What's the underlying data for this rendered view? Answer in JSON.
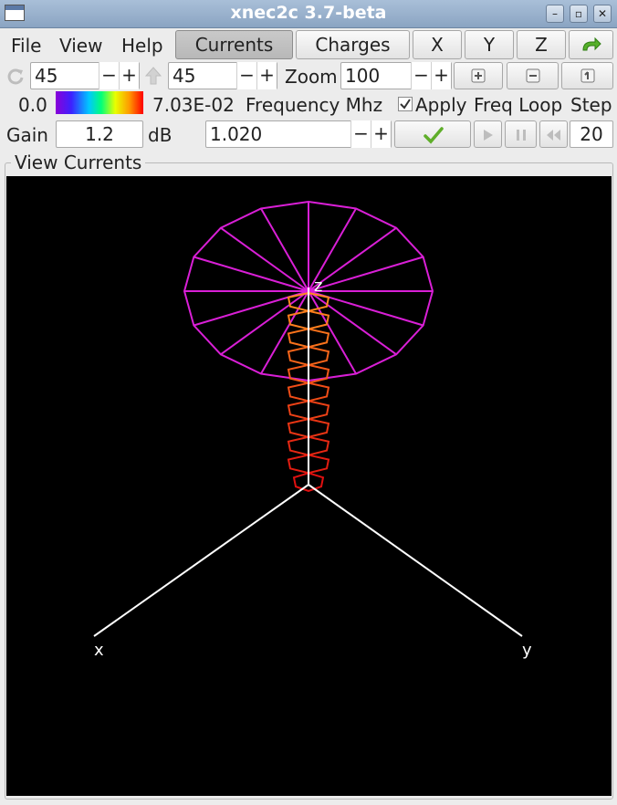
{
  "window": {
    "title": "xnec2c 3.7-beta"
  },
  "menus": [
    "File",
    "View",
    "Help"
  ],
  "toolbar": {
    "currents_label": "Currents",
    "charges_label": "Charges",
    "x_label": "X",
    "y_label": "Y",
    "z_label": "Z"
  },
  "row2": {
    "rotate_value": "45",
    "incline_value": "45",
    "zoom_label": "Zoom",
    "zoom_value": "100"
  },
  "row3": {
    "scale_min": "0.0",
    "scale_max": "7.03E-02",
    "frequency_label": "Frequency Mhz",
    "apply_label": "Apply",
    "freq_loop_label": "Freq Loop",
    "step_label": "Step",
    "apply_checked": true
  },
  "row4": {
    "gain_label": "Gain",
    "gain_value": "1.2",
    "db_label": "dB",
    "freq_value": "1.020",
    "step_value": "20"
  },
  "frame": {
    "title": "View Currents"
  },
  "view": {
    "axis_x": "x",
    "axis_y": "y",
    "axis_z": "z"
  },
  "colors": {
    "wire_disc": "#d91fd6",
    "coil_top": "#ff8a1e",
    "coil_bottom": "#e01010",
    "axis": "#ffffff"
  }
}
